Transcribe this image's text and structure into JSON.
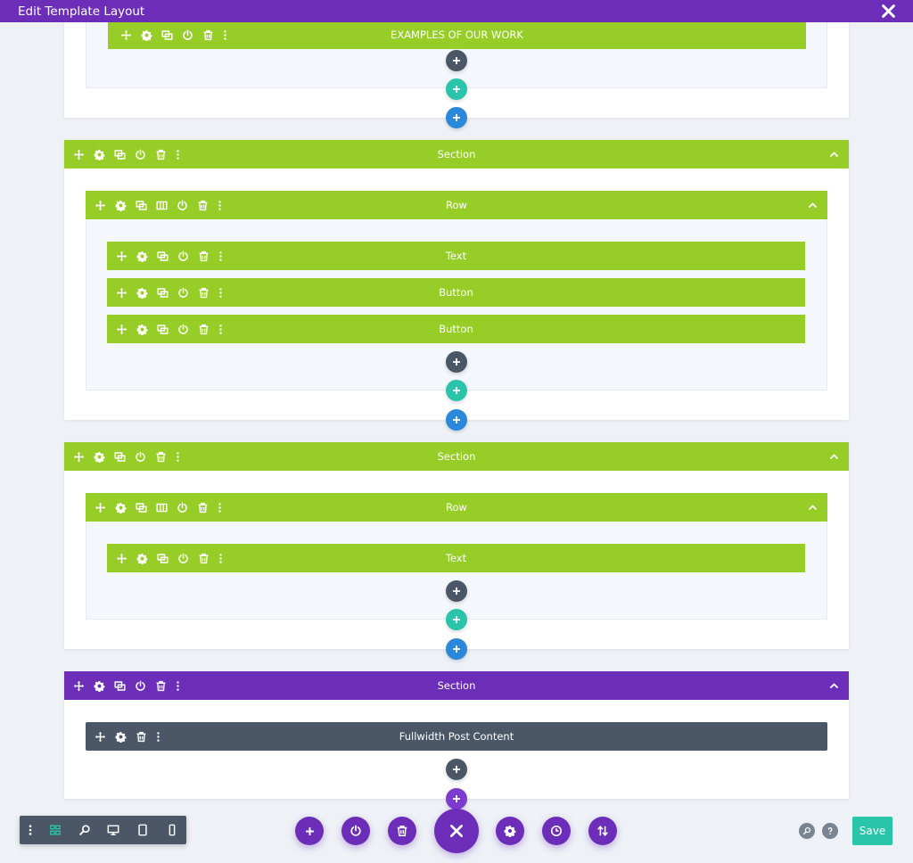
{
  "window": {
    "title": "Edit Template Layout"
  },
  "sections": [
    {
      "label": "",
      "rows": [
        {
          "label": "",
          "modules": [
            "EXAMPLES OF OUR WORK"
          ]
        }
      ]
    },
    {
      "label": "Section",
      "rows": [
        {
          "label": "Row",
          "modules": [
            "Text",
            "Button",
            "Button"
          ]
        }
      ]
    },
    {
      "label": "Section",
      "rows": [
        {
          "label": "Row",
          "modules": [
            "Text"
          ]
        }
      ]
    },
    {
      "label": "Section",
      "fullwidth_module": "Fullwidth Post Content"
    }
  ],
  "bottom_toolbar": {
    "left_tools": [
      "dots-menu-icon",
      "wireframe-view-icon",
      "zoom-icon",
      "desktop-view-icon",
      "tablet-view-icon",
      "phone-view-icon"
    ],
    "center_tools": [
      "add-icon",
      "power-icon",
      "trash-icon",
      "close-icon",
      "settings-icon",
      "history-icon",
      "sort-icon"
    ],
    "save_label": "Save"
  },
  "colors": {
    "titlebar": "#6c2eb9",
    "section_bar": "#97cd27",
    "fullwidth_section_bar": "#6c2eb9",
    "fullwidth_module_bar": "#4b5766",
    "add_module": "#4b5766",
    "add_row": "#29c4a9",
    "add_section": "#2b87da",
    "save": "#29c4a9"
  }
}
